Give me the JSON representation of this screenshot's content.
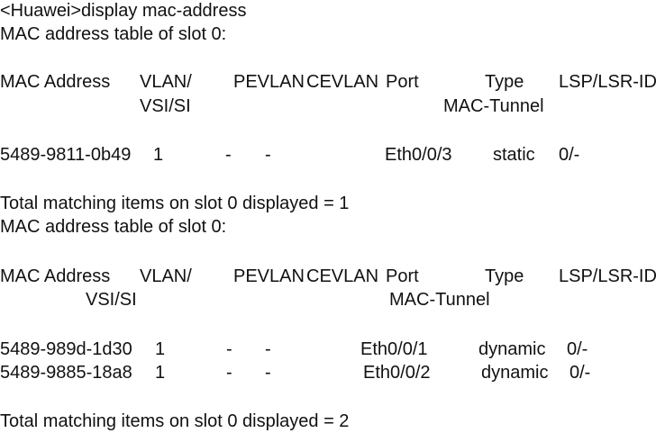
{
  "command_line": "<Huawei>display mac-address",
  "tables": [
    {
      "title": "MAC address table of slot 0:",
      "headers": {
        "mac": "MAC Address",
        "vlan": "VLAN/",
        "vsi": "VSI/SI",
        "pevlan": "PEVLAN",
        "cevlan": "CEVLAN",
        "port": "Port",
        "type": "Type",
        "mac_tunnel": "MAC-Tunnel",
        "lsp": "LSP/LSR-ID"
      },
      "rows": [
        {
          "mac": "5489-9811-0b49",
          "vlan": "1",
          "pevlan": "-",
          "cevlan": "-",
          "port": "Eth0/0/3",
          "type": "static",
          "lsp": "0/-"
        }
      ],
      "total": "Total matching items on slot 0 displayed = 1"
    },
    {
      "title": "MAC address table of slot 0:",
      "headers": {
        "mac": "MAC Address",
        "vlan": "VLAN/",
        "vsi": "VSI/SI",
        "pevlan": "PEVLAN",
        "cevlan": "CEVLAN",
        "port": "Port",
        "type": "Type",
        "mac_tunnel": "MAC-Tunnel",
        "lsp": "LSP/LSR-ID"
      },
      "rows": [
        {
          "mac": "5489-989d-1d30",
          "vlan": "1",
          "pevlan": "-",
          "cevlan": "-",
          "port": "Eth0/0/1",
          "type": "dynamic",
          "lsp": "0/-"
        },
        {
          "mac": "5489-9885-18a8",
          "vlan": "1",
          "pevlan": "-",
          "cevlan": "-",
          "port": "Eth0/0/2",
          "type": "dynamic",
          "lsp": "0/-"
        }
      ],
      "total": "Total matching items on slot 0 displayed = 2"
    }
  ]
}
